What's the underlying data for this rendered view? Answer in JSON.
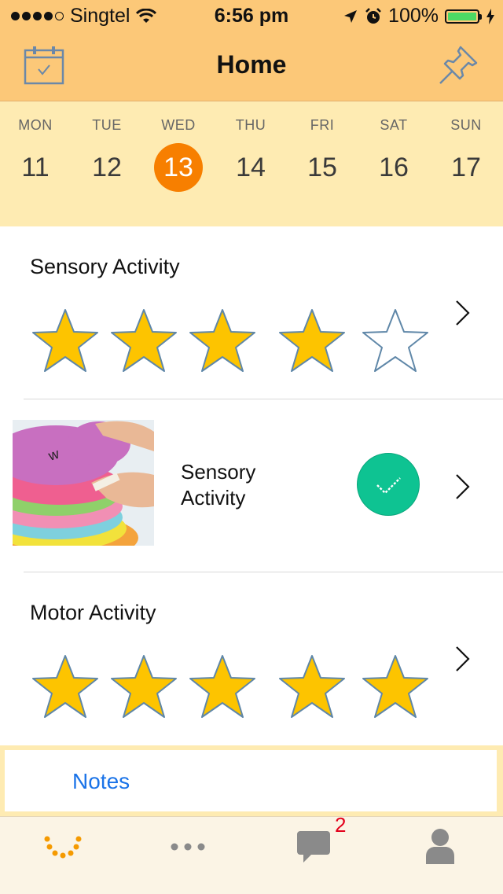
{
  "status_bar": {
    "carrier": "Singtel",
    "time": "6:56 pm",
    "battery": "100%",
    "battery_level": 1.0
  },
  "nav": {
    "title": "Home",
    "left_icon": "calendar-icon",
    "right_icon": "pin-icon"
  },
  "week": {
    "days": [
      {
        "dow": "MON",
        "num": "11"
      },
      {
        "dow": "TUE",
        "num": "12"
      },
      {
        "dow": "WED",
        "num": "13",
        "selected": true
      },
      {
        "dow": "THU",
        "num": "14"
      },
      {
        "dow": "FRI",
        "num": "15"
      },
      {
        "dow": "SAT",
        "num": "16"
      },
      {
        "dow": "SUN",
        "num": "17"
      }
    ],
    "selected_color": "#f77f00"
  },
  "ratings": [
    {
      "title": "Sensory Activity",
      "rating": 4,
      "max": 5
    },
    {
      "title": "Motor Activity",
      "rating": 5,
      "max": 5
    }
  ],
  "activity": {
    "title_line1": "Sensory",
    "title_line2": "Activity",
    "completed": true,
    "check_color": "#0ec392"
  },
  "notes": {
    "label": "Notes"
  },
  "tabbar": {
    "tabs": [
      "home-smile-icon",
      "more-dots-icon",
      "chat-bubble-icon",
      "profile-icon"
    ],
    "chat_badge": "2",
    "active_color": "#f59a00"
  },
  "colors": {
    "header_bg": "#fcc878",
    "week_bg": "#feebb2",
    "star_fill": "#fdc400",
    "star_stroke": "#5f87a8"
  }
}
